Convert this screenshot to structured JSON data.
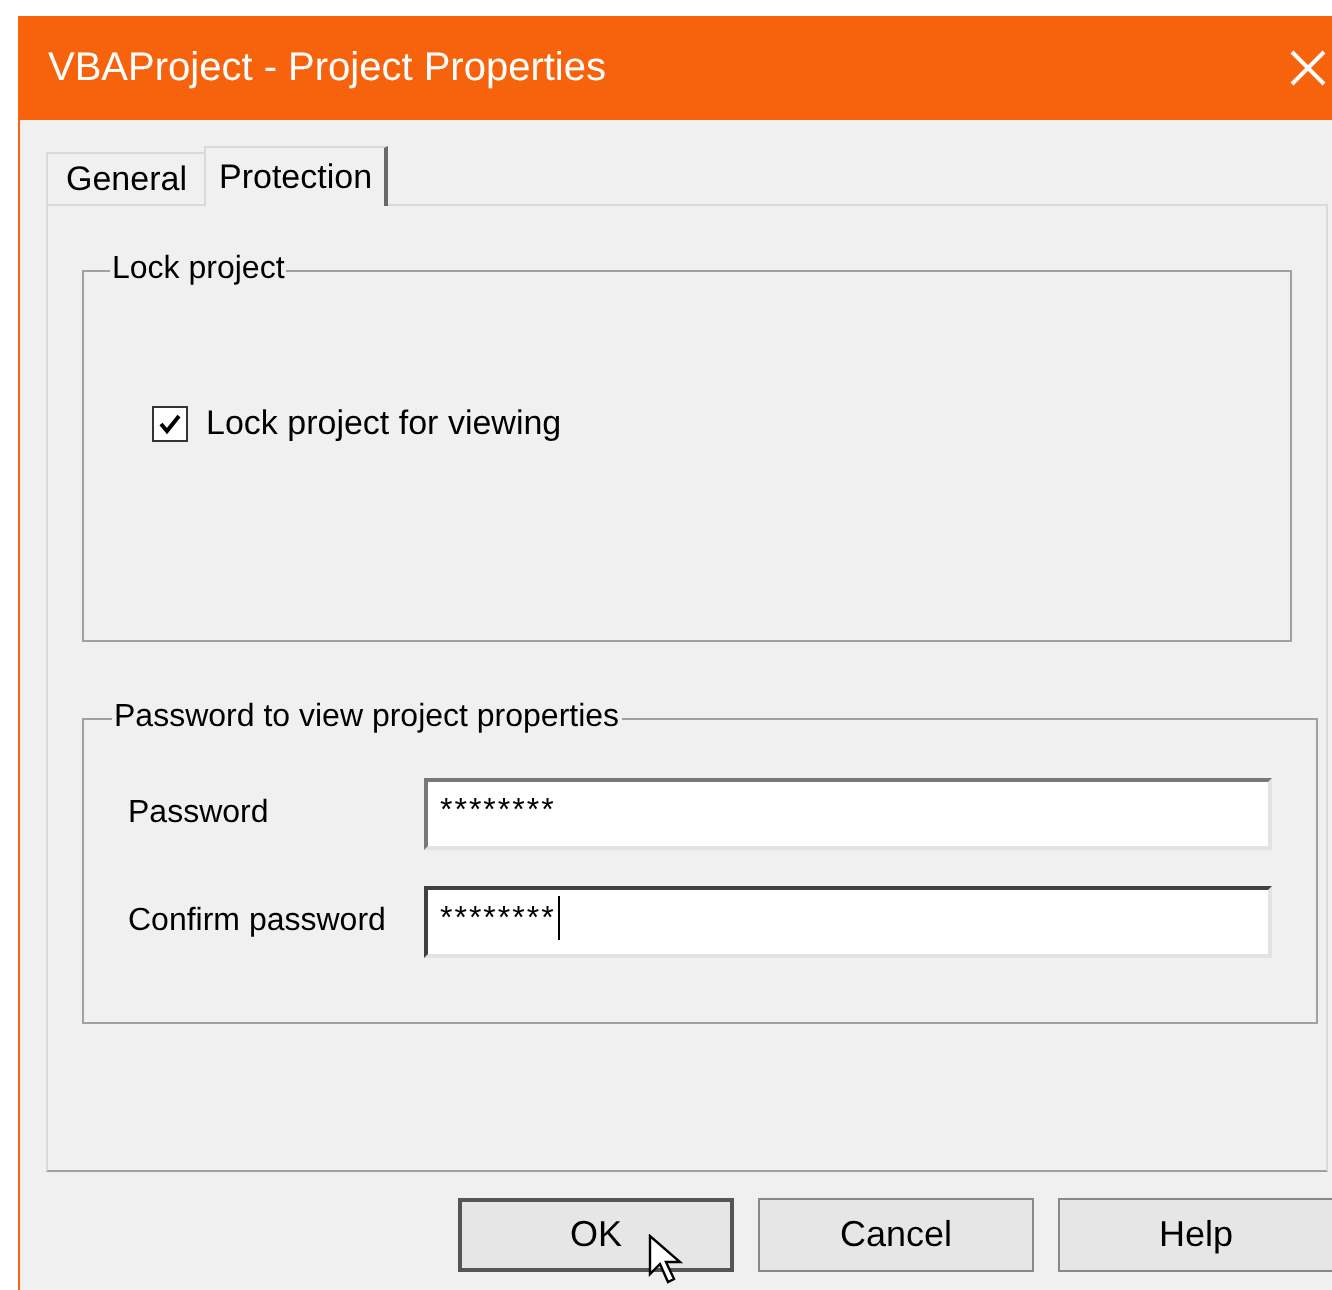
{
  "window": {
    "title": "VBAProject - Project Properties"
  },
  "tabs": [
    {
      "label": "General",
      "selected": false
    },
    {
      "label": "Protection",
      "selected": true
    }
  ],
  "lock_group": {
    "title": "Lock project",
    "checkbox": {
      "label": "Lock project for viewing",
      "checked": true
    }
  },
  "password_group": {
    "title": "Password to view project properties",
    "fields": [
      {
        "label": "Password",
        "value": "********",
        "focused": false
      },
      {
        "label": "Confirm password",
        "value": "********",
        "focused": true
      }
    ]
  },
  "buttons": [
    {
      "label": "OK",
      "default": true
    },
    {
      "label": "Cancel",
      "default": false
    },
    {
      "label": "Help",
      "default": false
    }
  ]
}
